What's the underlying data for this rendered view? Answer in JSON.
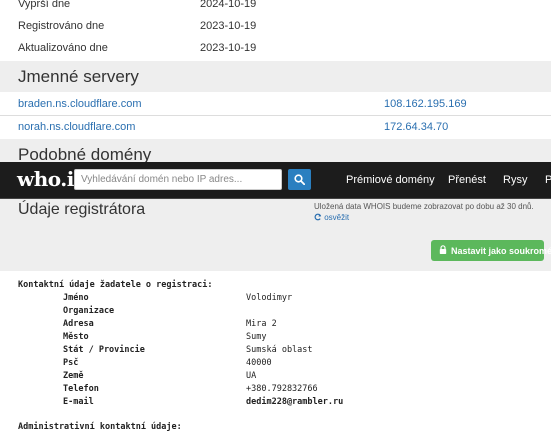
{
  "dates": [
    {
      "label": "Vyprší dne",
      "value": "2024-10-19"
    },
    {
      "label": "Registrováno dne",
      "value": "2023-10-19"
    },
    {
      "label": "Aktualizováno dne",
      "value": "2023-10-19"
    }
  ],
  "nameservers": {
    "title": "Jmenné servery",
    "rows": [
      {
        "host": "braden.ns.cloudflare.com",
        "ip": "108.162.195.169"
      },
      {
        "host": "norah.ns.cloudflare.com",
        "ip": "172.64.34.70"
      }
    ]
  },
  "similar": {
    "title": "Podobné domény"
  },
  "topbar": {
    "logo": "who.is",
    "search_placeholder": "Vyhledávání domén nebo IP adres...",
    "nav": [
      "Prémiové domény",
      "Přenést",
      "Rysy",
      "P"
    ]
  },
  "registrar": {
    "title": "Údaje registrátora",
    "cache_note": "Uložená data WHOIS budeme zobrazovat po dobu až 30 dnů.",
    "refresh": "osvěžit",
    "private_button": "Nastavit jako soukromé"
  },
  "whois": {
    "registrant_heading": "Kontaktní údaje žadatele o registraci:",
    "fields": [
      {
        "label": "Jméno",
        "value": "Volodimyr"
      },
      {
        "label": "Organizace",
        "value": ""
      },
      {
        "label": "Adresa",
        "value": "Mira 2"
      },
      {
        "label": "Město",
        "value": "Sumy"
      },
      {
        "label": "Stát / Provincie",
        "value": "Sumská oblast"
      },
      {
        "label": "Psč",
        "value": "40000"
      },
      {
        "label": "Země",
        "value": "UA"
      },
      {
        "label": "Telefon",
        "value": "+380.792832766"
      },
      {
        "label": "E-mail",
        "value": "dedim228@rambler.ru"
      }
    ],
    "admin_heading": "Administrativní kontaktní údaje:"
  },
  "colors": {
    "link": "#2a6fb0",
    "topbar": "#1c1c1c",
    "search_button": "#2a7fc0",
    "private_button": "#5cb85c",
    "section_bg": "#eeeeee"
  }
}
